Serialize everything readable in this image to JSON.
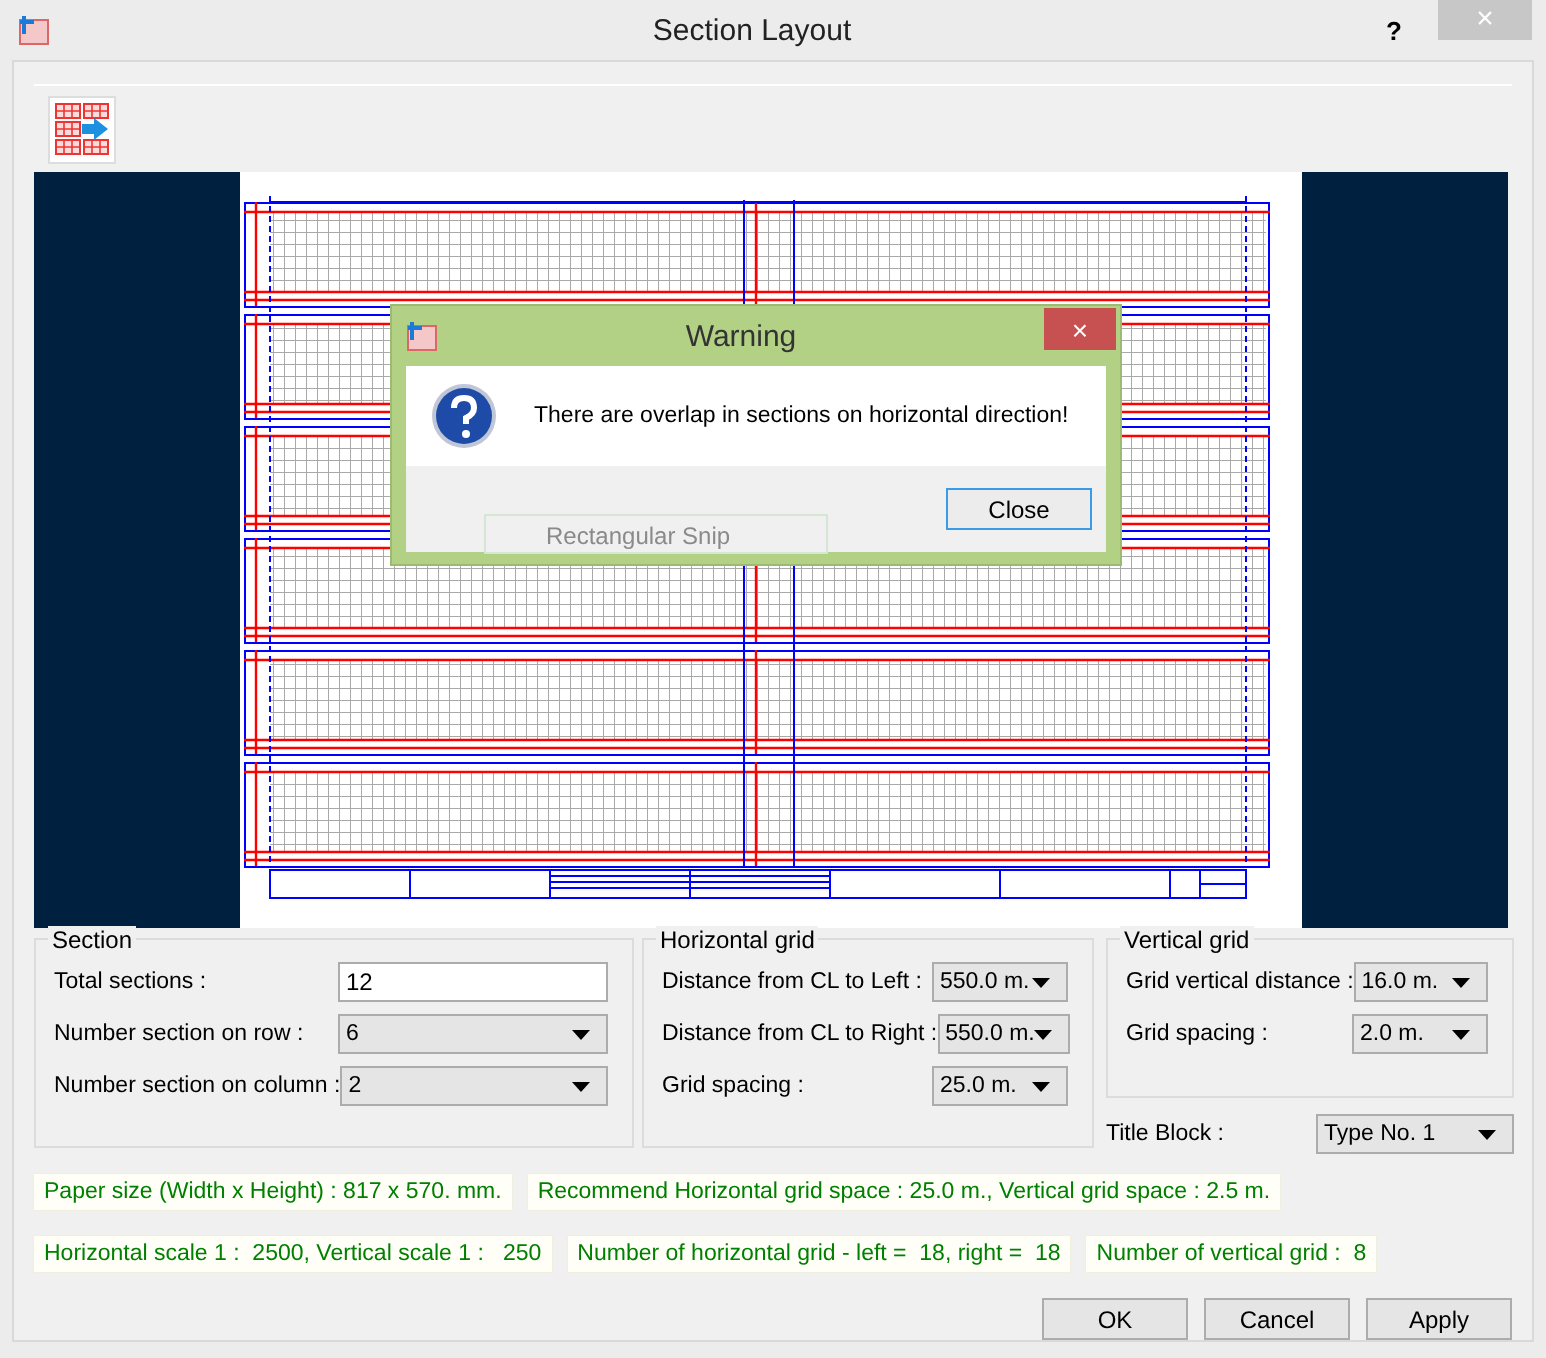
{
  "window": {
    "title": "Section Layout",
    "help": "?",
    "close": "×"
  },
  "warning": {
    "title": "Warning",
    "close": "×",
    "message": "There are overlap in sections on horizontal direction!",
    "button": "Close"
  },
  "ghost_item": {
    "label": "Rectangular Snip"
  },
  "groups": [
    {
      "title": "Section",
      "fields": [
        {
          "label": "Total sections :",
          "value": "12",
          "kind": "text"
        },
        {
          "label": "Number section on row :",
          "value": "6",
          "kind": "dropdown"
        },
        {
          "label": "Number section on column :",
          "value": "2",
          "kind": "dropdown"
        }
      ]
    },
    {
      "title": "Horizontal grid",
      "fields": [
        {
          "label": "Distance from CL to Left :",
          "value": "550.0 m.",
          "kind": "dropdown"
        },
        {
          "label": "Distance from CL to Right :",
          "value": "550.0 m.",
          "kind": "dropdown"
        },
        {
          "label": "Grid spacing :",
          "value": "25.0 m.",
          "kind": "dropdown"
        }
      ]
    },
    {
      "title": "Vertical grid",
      "fields": [
        {
          "label": "Grid vertical distance :",
          "value": "16.0 m.",
          "kind": "dropdown"
        },
        {
          "label": "Grid spacing :",
          "value": "2.0 m.",
          "kind": "dropdown"
        }
      ]
    }
  ],
  "title_block": {
    "label": "Title Block :",
    "value": "Type No. 1"
  },
  "info_rows": [
    [
      "Paper size (Width x Height) : 817 x 570. mm.",
      "Recommend Horizontal grid space : 25.0 m., Vertical grid space : 2.5 m."
    ],
    [
      "Horizontal scale 1 :  2500, Vertical scale 1 :   250",
      "Number of horizontal grid - left =  18, right =  18",
      "Number of vertical grid :  8"
    ]
  ],
  "buttons": [
    "OK",
    "Cancel",
    "Apply"
  ]
}
